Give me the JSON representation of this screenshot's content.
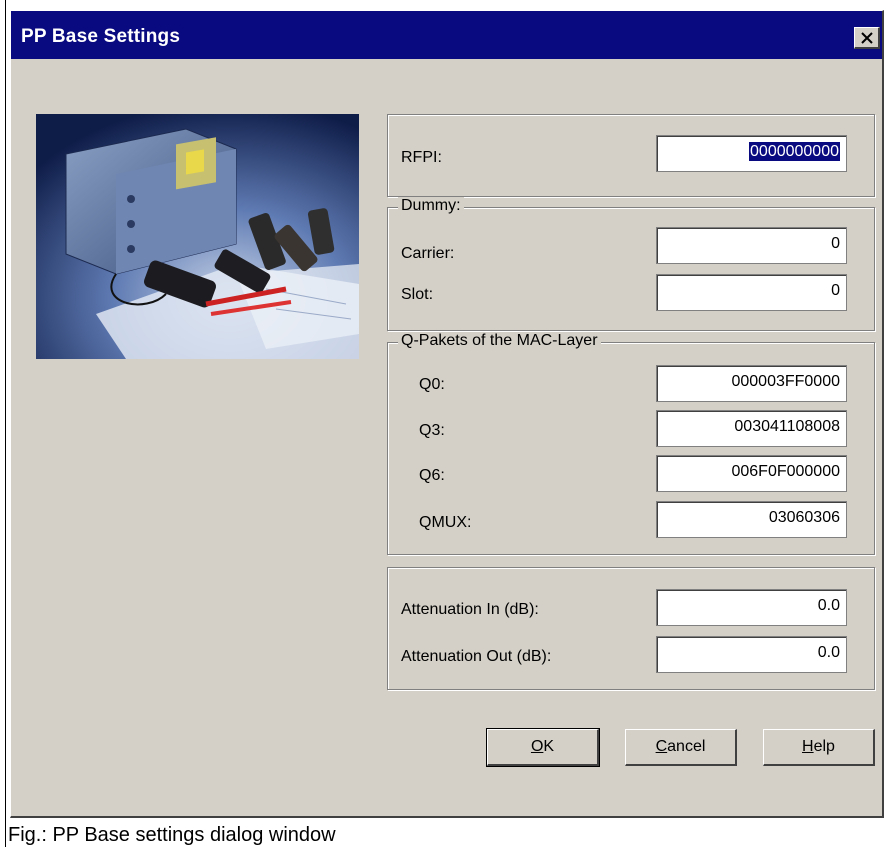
{
  "dialog": {
    "title": "PP Base Settings",
    "close_label": "×"
  },
  "rfpi": {
    "label": "RFPI:",
    "value": "0000000000"
  },
  "dummy": {
    "legend": "Dummy:",
    "carrier": {
      "label": "Carrier:",
      "value": "0"
    },
    "slot": {
      "label": "Slot:",
      "value": "0"
    }
  },
  "qpackets": {
    "legend": "Q-Pakets of the MAC-Layer",
    "q0": {
      "label": "Q0:",
      "value": "000003FF0000"
    },
    "q3": {
      "label": "Q3:",
      "value": "003041108008"
    },
    "q6": {
      "label": "Q6:",
      "value": "006F0F000000"
    },
    "qmux": {
      "label": "QMUX:",
      "value": "03060306"
    }
  },
  "attenuation": {
    "in": {
      "label": "Attenuation In (dB):",
      "value": "0.0"
    },
    "out": {
      "label": "Attenuation Out (dB):",
      "value": "0.0"
    }
  },
  "buttons": {
    "ok": {
      "mnemonic": "O",
      "rest": "K"
    },
    "cancel": {
      "mnemonic": "C",
      "rest": "ancel"
    },
    "help": {
      "mnemonic": "H",
      "rest": "elp"
    }
  },
  "caption": "Fig.: PP Base settings dialog window",
  "colors": {
    "titlebar": "#0a0a80",
    "face": "#d4d0c8",
    "selection": "#0a0a80"
  },
  "icons": {
    "close": "close-icon"
  }
}
